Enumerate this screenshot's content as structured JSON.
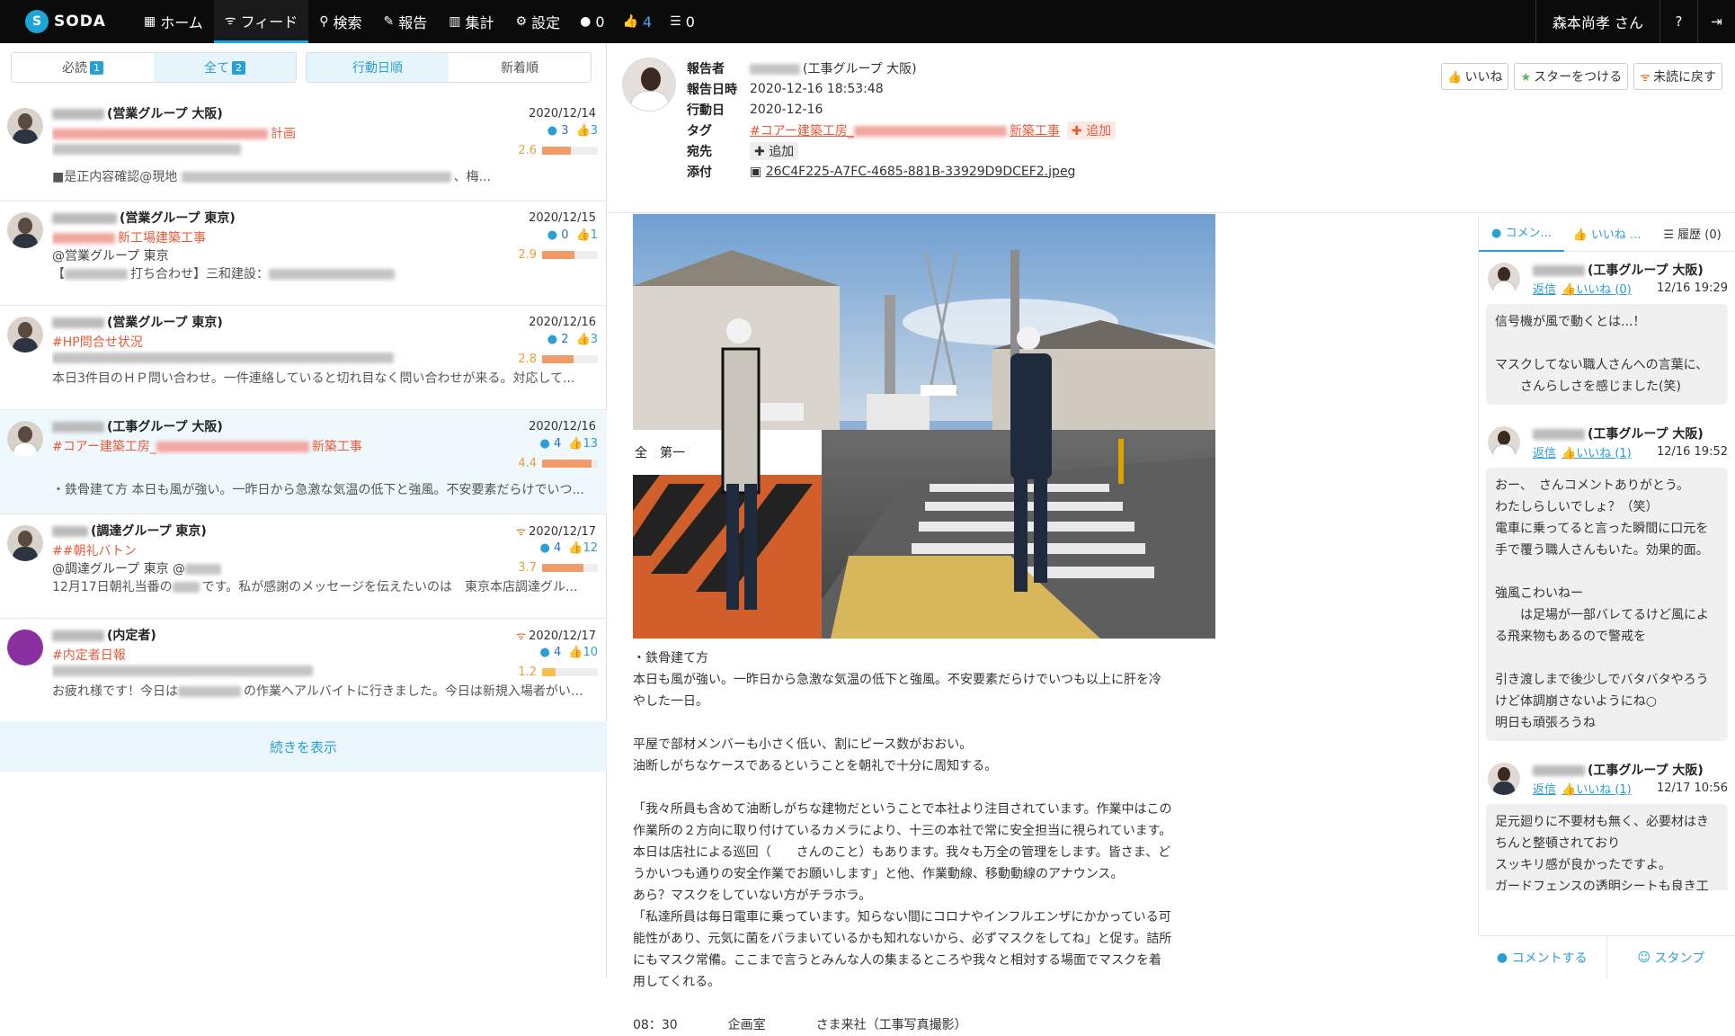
{
  "app": {
    "logo_mark": "S",
    "logo_text": "SODA"
  },
  "nav": {
    "home": "ホーム",
    "feed": "フィード",
    "search": "検索",
    "report": "報告",
    "stats": "集計",
    "settings": "設定",
    "comments_count": "0",
    "likes_count": "4",
    "list_count": "0"
  },
  "user": {
    "name": "森本尚孝 さん"
  },
  "filters": {
    "must_read": "必読",
    "must_read_count": "1",
    "all": "全て",
    "all_count": "2",
    "action_date": "行動日順",
    "newest": "新着順"
  },
  "feed": [
    {
      "name": "(営業グループ 大阪)",
      "date": "2020/12/14",
      "tag": "計画",
      "comments": "3",
      "likes": "3",
      "score": "2.6",
      "line3": "",
      "summary": "■是正内容確認@現地",
      "summary_tail": "、梅..."
    },
    {
      "name": "(営業グループ 東京)",
      "date": "2020/12/15",
      "tag": "新工場建築工事",
      "comments": "0",
      "likes": "1",
      "score": "2.9",
      "line3": "@営業グループ 東京",
      "summary": "【",
      "summary_tail": "打ち合わせ】三和建設："
    },
    {
      "name": "(営業グループ 東京)",
      "date": "2020/12/16",
      "tag": "#HP問合せ状況",
      "comments": "2",
      "likes": "3",
      "score": "2.8",
      "line3": "",
      "summary": "本日3件目のＨＰ問い合わせ。一件連絡していると切れ目なく問い合わせが来る。対応して..."
    },
    {
      "name": "(工事グループ 大阪)",
      "date": "2020/12/16",
      "tag": "#コアー建築工房_",
      "tag_tail": "新築工事",
      "comments": "4",
      "likes": "13",
      "score": "4.4",
      "line3": "",
      "summary": "・鉄骨建て方 本日も風が強い。一昨日から急激な気温の低下と強風。不安要素だらけでいつ..."
    },
    {
      "name": "(調達グループ 東京)",
      "date": "2020/12/17",
      "tag": "##朝礼バトン",
      "comments": "4",
      "likes": "12",
      "score": "3.7",
      "line3": "@調達グループ 東京 @",
      "summary": "12月17日朝礼当番の",
      "summary_tail": "です。私が感謝のメッセージを伝えたいのは　東京本店調達グル..."
    },
    {
      "name": "(内定者)",
      "date": "2020/12/17",
      "tag": "#内定者日報",
      "comments": "4",
      "likes": "10",
      "score": "1.2",
      "line3": "",
      "summary": "お疲れ様です！今日は",
      "summary_tail": "の作業へアルバイトに行きました。今日は新規入場者がいつ..."
    }
  ],
  "more_label": "続きを表示",
  "report": {
    "reporter_label": "報告者",
    "reporter_value": "(工事グループ 大阪)",
    "datetime_label": "報告日時",
    "datetime_value": "2020-12-16 18:53:48",
    "action_label": "行動日",
    "action_value": "2020-12-16",
    "tag_label": "タグ",
    "tag_value": "#コアー建築工房_",
    "tag_tail": "新築工事",
    "to_label": "宛先",
    "attach_label": "添付",
    "attach_value": "26C4F225-A7FC-4685-881B-33929D9DCEF2.jpeg",
    "add_label": "追加"
  },
  "actions": {
    "like": "いいね",
    "star": "スターをつける",
    "unread": "未読に戻す"
  },
  "photo_text": {
    "sign_line1": "全",
    "sign_line2": "第一"
  },
  "content": [
    "・鉄骨建て方",
    "本日も風が強い。一昨日から急激な気温の低下と強風。不安要素だらけでいつも以上に肝を冷やした一日。",
    "",
    "平屋で部材メンバーも小さく低い、割にピース数がおおい。",
    "油断しがちなケースであるということを朝礼で十分に周知する。",
    "",
    "「我々所員も含めて油断しがちな建物だということで本社より注目されています。作業中はこの作業所の２方向に取り付けているカメラにより、十三の本社で常に安全担当に視られています。本日は店社による巡回（　　さんのこと）もあります。我々も万全の管理をします。皆さま、どうかいつも通りの安全作業でお願いします」と他、作業動線、移動動線のアナウンス。",
    "あら？マスクをしていない方がチラホラ。",
    "「私達所員は毎日電車に乗っています。知らない間にコロナやインフルエンザにかかっている可能性があり、元気に菌をバラまいているかも知れないから、必ずマスクをしてね」と促す。詰所にもマスク常備。ここまで言うとみんな人の集まるところや我々と相対する場面でマスクを着用してくれる。",
    "",
    "08：30　　　　企画室　　　　さま来社（工事写真撮影）"
  ],
  "side_tabs": {
    "comments": "コメン...",
    "likes": "いいね ...",
    "history": "履歴 (0)"
  },
  "comments": [
    {
      "name": "(工事グループ 大阪)",
      "reply": "返信",
      "like": "いいね (0)",
      "time": "12/16 19:29",
      "text": "信号機が風で動くとは...！\n\nマスクしてない職人さんへの言葉に、\n　　さんらしさを感じました(笑)"
    },
    {
      "name": "(工事グループ 大阪)",
      "reply": "返信",
      "like": "いいね (1)",
      "time": "12/16 19:52",
      "text": "おー、　さんコメントありがとう。\nわたしらしいでしょ？（笑）\n電車に乗ってると言った瞬間に口元を\n手で覆う職人さんもいた。効果的面。\n\n強風こわいねー\n　　は足場が一部バレてるけど風によ\nる飛来物もあるので警戒を\n\n引き渡しまで後少しでバタバタやろう\nけど体調崩さないようにね○\n明日も頑張ろうね"
    },
    {
      "name": "(工事グループ 大阪)",
      "reply": "返信",
      "like": "いいね (1)",
      "time": "12/17 10:56",
      "text": "足元廻りに不要材も無く、必要材はき\nちんと整頓されており\nスッキリ感が良かったですよ。\nガードフェンスの透明シートも良き工"
    }
  ],
  "footer": {
    "comment": "コメントする",
    "stamp": "スタンプ"
  },
  "colors": {
    "accent": "#2a9fd6",
    "tag": "#e85b3a",
    "topbar": "#0b0b0b"
  }
}
